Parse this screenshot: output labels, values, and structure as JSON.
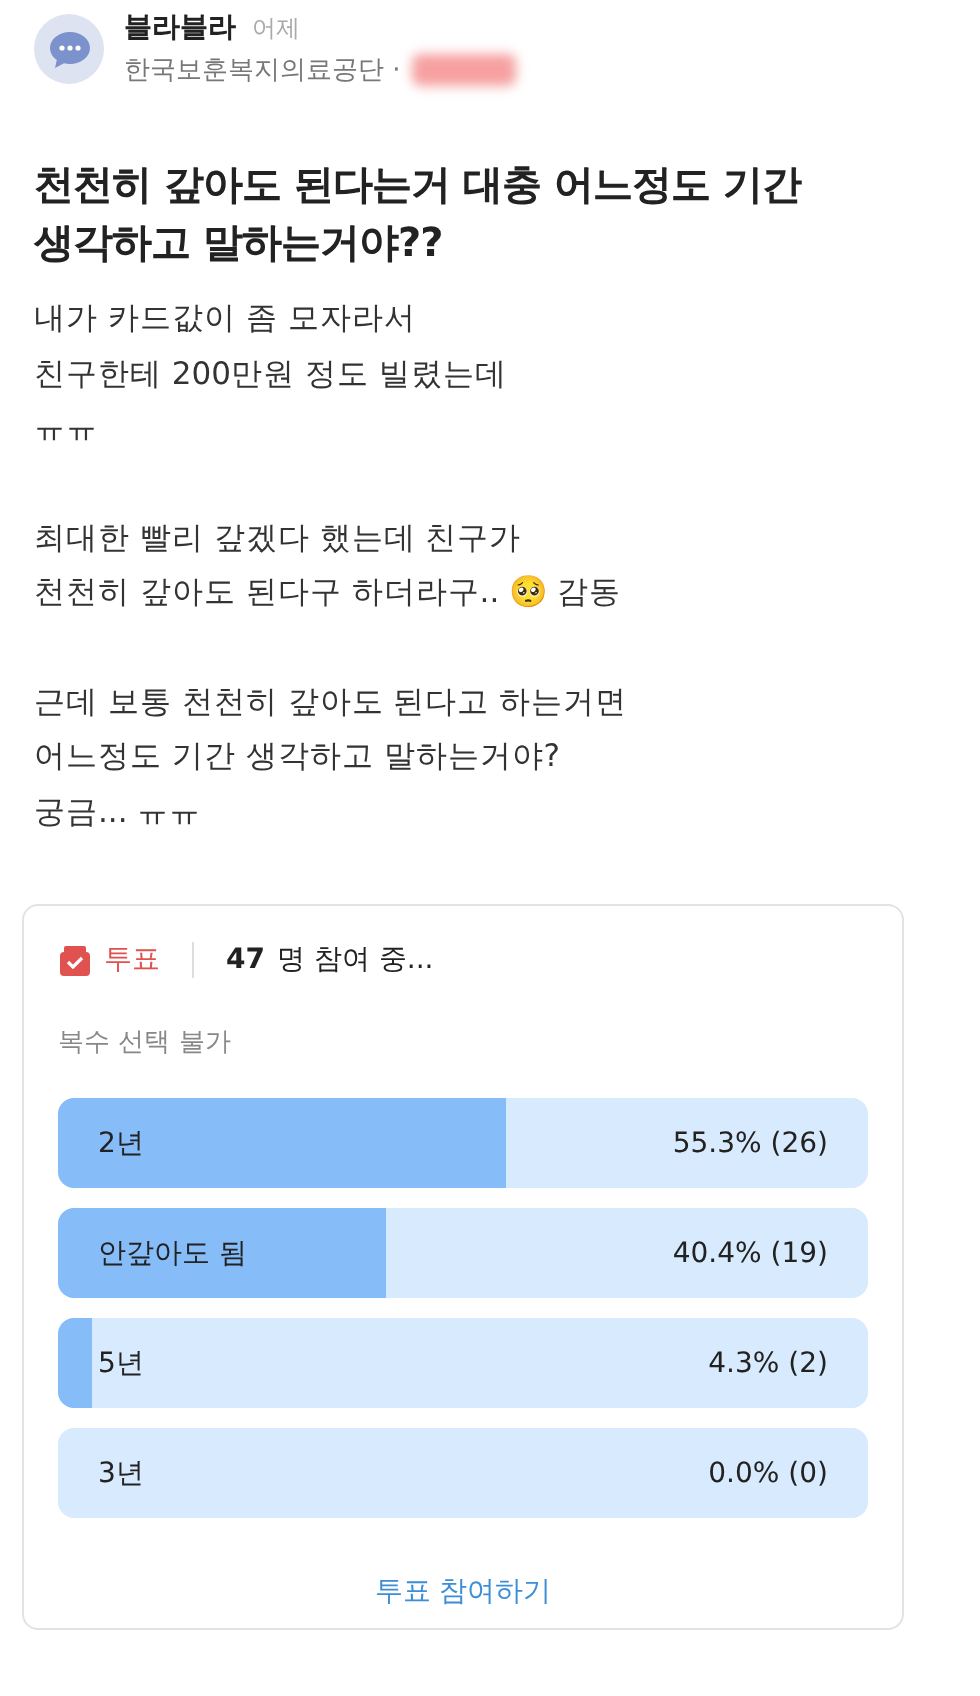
{
  "author": {
    "name": "블라블라",
    "time": "어제",
    "company": "한국보훈복지의료공단 ·"
  },
  "post": {
    "title": "천천히 갚아도 된다는거 대충 어느정도 기간 생각하고 말하는거야??",
    "paragraphs": [
      "내가 카드값이 좀 모자라서\n친구한테 200만원 정도 빌렸는데\nㅠㅠ",
      "최대한 빨리 갚겠다 했는데 친구가\n천천히 갚아도 된다구 하더라구.. 🥺 감동",
      "근데 보통 천천히 갚아도 된다고 하는거면\n어느정도 기간 생각하고 말하는거야?\n궁금... ㅠㅠ"
    ]
  },
  "poll": {
    "label": "투표",
    "count": "47",
    "participants": "명 참여 중...",
    "note": "복수 선택 불가",
    "options": [
      {
        "label": "2년",
        "result": "55.3% (26)",
        "level": 0.553
      },
      {
        "label": "안갚아도 됨",
        "result": "40.4% (19)",
        "level": 0.404
      },
      {
        "label": "5년",
        "result": "4.3% (2)",
        "level": 0.043
      },
      {
        "label": "3년",
        "result": "0.0% (0)"
      }
    ],
    "action": "투표 참여하기"
  }
}
